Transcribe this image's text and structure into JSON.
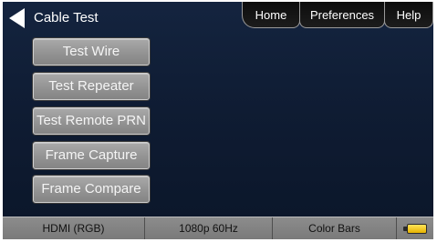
{
  "header": {
    "title": "Cable Test",
    "back_icon": "left-triangle-icon"
  },
  "tabs": {
    "home": "Home",
    "preferences": "Preferences",
    "help": "Help"
  },
  "menu": {
    "items": [
      {
        "label": "Test Wire"
      },
      {
        "label": "Test Repeater"
      },
      {
        "label": "Test Remote PRN"
      },
      {
        "label": "Frame Capture"
      },
      {
        "label": "Frame Compare"
      }
    ]
  },
  "status": {
    "input": "HDMI (RGB)",
    "resolution": "1080p 60Hz",
    "pattern": "Color Bars",
    "battery_icon": "battery-icon"
  },
  "colors": {
    "background": "#0f1c33",
    "button": "#939393",
    "status_bar": "#7a7a7a",
    "battery": "#ffd000"
  }
}
